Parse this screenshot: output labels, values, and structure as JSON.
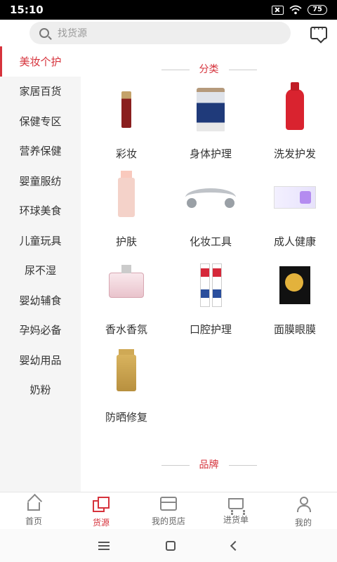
{
  "status_bar": {
    "time": "15:10",
    "battery": "75"
  },
  "search": {
    "placeholder": "找货源"
  },
  "sidebar": {
    "items": [
      {
        "label": "美妆个护",
        "active": true
      },
      {
        "label": "家居百货"
      },
      {
        "label": "保健专区"
      },
      {
        "label": "营养保健"
      },
      {
        "label": "婴童服纺"
      },
      {
        "label": "环球美食"
      },
      {
        "label": "儿童玩具"
      },
      {
        "label": "尿不湿"
      },
      {
        "label": "婴幼辅食"
      },
      {
        "label": "孕妈必备"
      },
      {
        "label": "婴幼用品"
      },
      {
        "label": "奶粉"
      }
    ]
  },
  "category_section": {
    "title": "分类",
    "items": [
      {
        "label": "彩妆",
        "icon": "lip-gloss-image"
      },
      {
        "label": "身体护理",
        "icon": "body-lotion-tube-image"
      },
      {
        "label": "洗发护发",
        "icon": "shampoo-bottle-image"
      },
      {
        "label": "护肤",
        "icon": "toner-bottle-image"
      },
      {
        "label": "化妆工具",
        "icon": "face-roller-image"
      },
      {
        "label": "成人健康",
        "icon": "product-box-image"
      },
      {
        "label": "香水香氛",
        "icon": "perfume-bottle-image"
      },
      {
        "label": "口腔护理",
        "icon": "toothpaste-image"
      },
      {
        "label": "面膜眼膜",
        "icon": "face-mask-box-image"
      },
      {
        "label": "防晒修复",
        "icon": "sunscreen-bottle-image"
      }
    ]
  },
  "brand_section": {
    "title": "品牌"
  },
  "bottom_nav": {
    "items": [
      {
        "label": "首页",
        "icon": "home-icon"
      },
      {
        "label": "货源",
        "icon": "source-icon",
        "active": true
      },
      {
        "label": "我的觅店",
        "icon": "store-icon"
      },
      {
        "label": "进货单",
        "icon": "cart-icon"
      },
      {
        "label": "我的",
        "icon": "user-icon"
      }
    ]
  },
  "colors": {
    "accent": "#d6333c",
    "sidebar_bg": "#f5f5f5",
    "search_bg": "#eeeeee"
  }
}
